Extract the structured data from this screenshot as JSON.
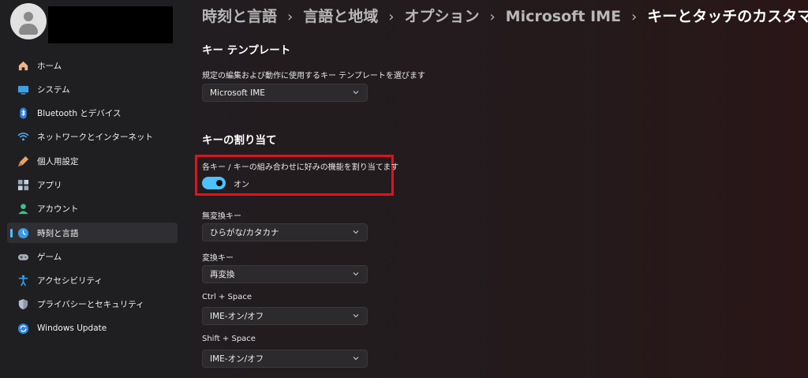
{
  "sidebar": {
    "items": [
      {
        "label": "ホーム",
        "icon": "home-icon"
      },
      {
        "label": "システム",
        "icon": "system-icon"
      },
      {
        "label": "Bluetooth とデバイス",
        "icon": "bluetooth-icon"
      },
      {
        "label": "ネットワークとインターネット",
        "icon": "network-icon"
      },
      {
        "label": "個人用設定",
        "icon": "personalization-icon"
      },
      {
        "label": "アプリ",
        "icon": "apps-icon"
      },
      {
        "label": "アカウント",
        "icon": "account-icon"
      },
      {
        "label": "時刻と言語",
        "icon": "time-language-icon",
        "selected": true
      },
      {
        "label": "ゲーム",
        "icon": "gaming-icon"
      },
      {
        "label": "アクセシビリティ",
        "icon": "accessibility-icon"
      },
      {
        "label": "プライバシーとセキュリティ",
        "icon": "privacy-icon"
      },
      {
        "label": "Windows Update",
        "icon": "update-icon"
      }
    ]
  },
  "breadcrumb": [
    "時刻と言語",
    "言語と地域",
    "オプション",
    "Microsoft IME",
    "キーとタッチのカスタマイズ"
  ],
  "sections": {
    "key_template": {
      "title": "キー テンプレート",
      "description": "規定の編集および動作に使用するキー テンプレートを選びます",
      "value": "Microsoft IME"
    },
    "key_assignment": {
      "title": "キーの割り当て",
      "toggle_label": "各キー / キーの組み合わせに好みの機能を割り当てます",
      "toggle_state": "オン",
      "toggle_on": true,
      "settings": [
        {
          "label": "無変換キー",
          "value": "ひらがな/カタカナ"
        },
        {
          "label": "変換キー",
          "value": "再変換"
        },
        {
          "label": "Ctrl + Space",
          "value": "IME-オン/オフ"
        },
        {
          "label": "Shift + Space",
          "value": "IME-オン/オフ"
        }
      ]
    }
  },
  "colors": {
    "accent": "#4cc2ff",
    "highlight": "#e0121b"
  }
}
